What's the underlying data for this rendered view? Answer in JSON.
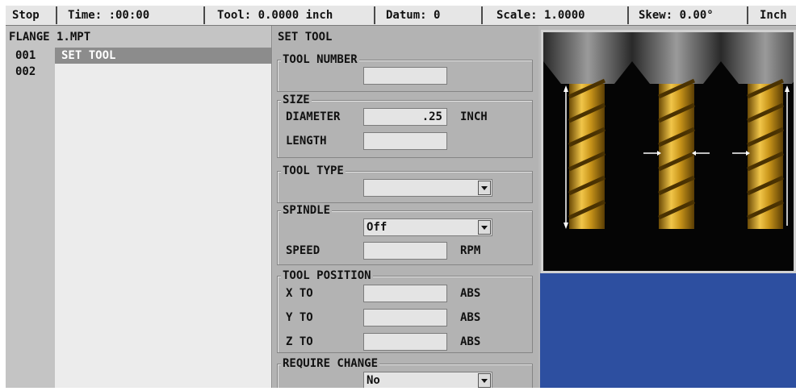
{
  "status_bar": {
    "state": "Stop",
    "time": "Time: :00:00",
    "tool": "Tool: 0.0000  inch",
    "datum": "Datum: 0",
    "scale": "Scale: 1.0000",
    "skew": "Skew: 0.00°",
    "units": "Inch"
  },
  "program": {
    "file_name": "FLANGE 1.MPT",
    "lines": [
      {
        "number": "001",
        "text": "SET TOOL",
        "selected": true
      },
      {
        "number": "002",
        "text": "",
        "selected": false
      }
    ]
  },
  "dialog": {
    "title": "SET TOOL",
    "tool_number": {
      "group_label": "TOOL NUMBER",
      "value": ""
    },
    "size": {
      "group_label": "SIZE",
      "diameter_label": "DIAMETER",
      "diameter_value": ".25",
      "diameter_unit": "INCH",
      "length_label": "LENGTH",
      "length_value": ""
    },
    "tool_type": {
      "group_label": "TOOL TYPE",
      "value": ""
    },
    "spindle": {
      "group_label": "SPINDLE",
      "value": "Off",
      "speed_label": "SPEED",
      "speed_value": "",
      "speed_unit": "RPM"
    },
    "tool_position": {
      "group_label": "TOOL POSITION",
      "x_label": "X TO",
      "x_value": "",
      "x_unit": "ABS",
      "y_label": "Y TO",
      "y_value": "",
      "y_unit": "ABS",
      "z_label": "Z TO",
      "z_value": "",
      "z_unit": "ABS"
    },
    "require_change": {
      "group_label": "REQUIRE CHANGE",
      "value": "No"
    }
  },
  "preview": {
    "images": [
      "tool-length-icon",
      "tool-diameter-icon",
      "tool-radius-icon"
    ]
  },
  "colors": {
    "background": "#b9b9b9",
    "selection": "#8c8c8c",
    "preview_panel": "#2d4fa0",
    "flute_gold": "#d6a520"
  }
}
